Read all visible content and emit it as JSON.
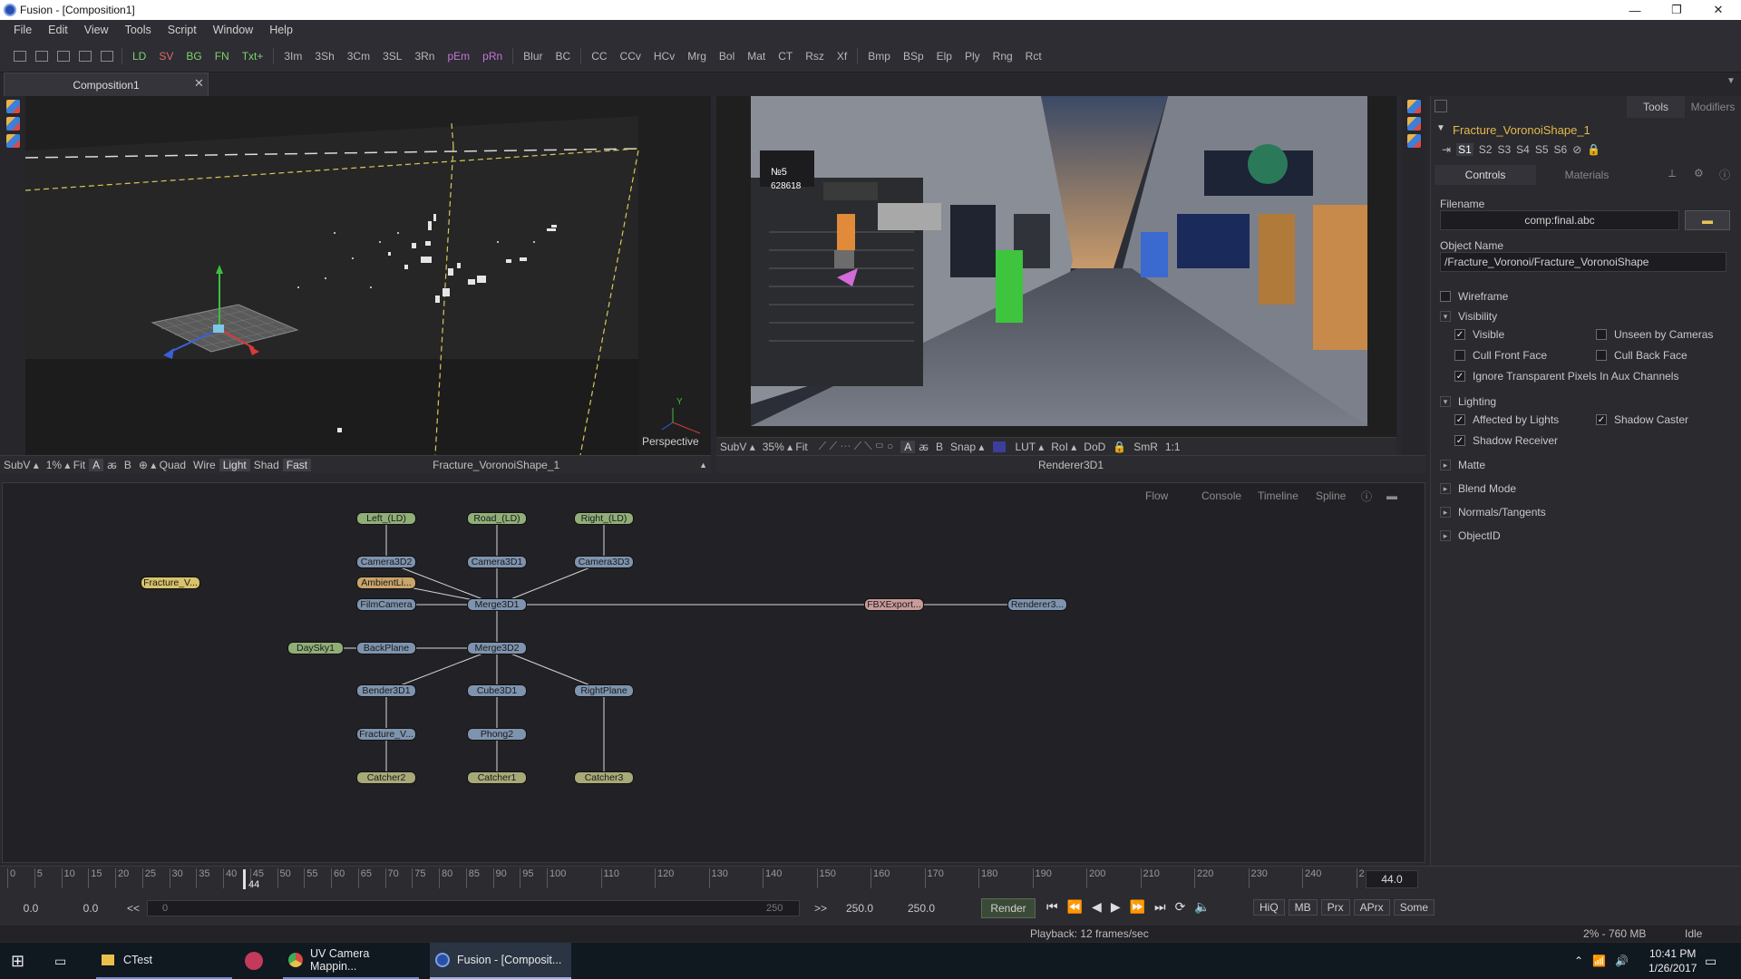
{
  "window": {
    "title": "Fusion - [Composition1]",
    "minimize": "—",
    "maximize": "❐",
    "close": "✕"
  },
  "menu": [
    "File",
    "Edit",
    "View",
    "Tools",
    "Script",
    "Window",
    "Help"
  ],
  "toolbar": [
    {
      "label": "LD",
      "color": "g"
    },
    {
      "label": "SV",
      "color": "r"
    },
    {
      "label": "BG",
      "color": "g"
    },
    {
      "label": "FN",
      "color": "g"
    },
    {
      "label": "Txt+",
      "color": "g"
    },
    {
      "label": "3Im"
    },
    {
      "label": "3Sh"
    },
    {
      "label": "3Cm"
    },
    {
      "label": "3SL"
    },
    {
      "label": "3Rn"
    },
    {
      "label": "pEm",
      "color": "p"
    },
    {
      "label": "pRn",
      "color": "p"
    },
    {
      "label": "Blur"
    },
    {
      "label": "BC"
    },
    {
      "label": "CC"
    },
    {
      "label": "CCv"
    },
    {
      "label": "HCv"
    },
    {
      "label": "Mrg"
    },
    {
      "label": "Bol"
    },
    {
      "label": "Mat"
    },
    {
      "label": "CT"
    },
    {
      "label": "Rsz"
    },
    {
      "label": "Xf"
    },
    {
      "label": "Bmp"
    },
    {
      "label": "BSp"
    },
    {
      "label": "Elp"
    },
    {
      "label": "Ply"
    },
    {
      "label": "Rng"
    },
    {
      "label": "Rct"
    }
  ],
  "tab": {
    "label": "Composition1",
    "close": "✕"
  },
  "viewer_left": {
    "label": "Perspective",
    "axis_y": "Y",
    "bar": [
      "SubV ▴",
      "1% ▴ Fit",
      "A",
      "ꬱ",
      "B",
      "⊕ ▴ Quad",
      "Wire",
      "Light",
      "Shad",
      "Fast"
    ],
    "node": "Fracture_VoronoiShape_1"
  },
  "viewer_right": {
    "bar": [
      "SubV ▴",
      "35% ▴ Fit",
      "A",
      "ꬱ",
      "B",
      "Snap ▴",
      "LUT ▴",
      "RoI ▴",
      "DoD",
      "SmR",
      "1:1"
    ],
    "node": "Renderer3D1",
    "sign_text": "№5",
    "shop_code": "628618"
  },
  "flow_tabs": [
    "Flow",
    "Console",
    "Timeline",
    "Spline"
  ],
  "nodes": [
    {
      "label": "Left_(LD)",
      "cls": "n-green"
    },
    {
      "label": "Road_(LD)",
      "cls": "n-green"
    },
    {
      "label": "Right_(LD)",
      "cls": "n-green"
    },
    {
      "label": "Camera3D2",
      "cls": "n-blue"
    },
    {
      "label": "Camera3D1",
      "cls": "n-blue"
    },
    {
      "label": "Camera3D3",
      "cls": "n-blue"
    },
    {
      "label": "Fracture_V...",
      "cls": "n-yellow"
    },
    {
      "label": "AmbientLi...",
      "cls": "n-orange"
    },
    {
      "label": "FilmCamera",
      "cls": "n-blue"
    },
    {
      "label": "Merge3D1",
      "cls": "n-blue"
    },
    {
      "label": "FBXExport...",
      "cls": "n-pink"
    },
    {
      "label": "Renderer3...",
      "cls": "n-blue"
    },
    {
      "label": "DaySky1",
      "cls": "n-green"
    },
    {
      "label": "BackPlane",
      "cls": "n-blue"
    },
    {
      "label": "Merge3D2",
      "cls": "n-blue"
    },
    {
      "label": "Bender3D1",
      "cls": "n-blue"
    },
    {
      "label": "Cube3D1",
      "cls": "n-blue"
    },
    {
      "label": "RightPlane",
      "cls": "n-blue"
    },
    {
      "label": "Fracture_V...",
      "cls": "n-blue"
    },
    {
      "label": "Phong2",
      "cls": "n-blue"
    },
    {
      "label": "Catcher2",
      "cls": "n-olive"
    },
    {
      "label": "Catcher1",
      "cls": "n-olive"
    },
    {
      "label": "Catcher3",
      "cls": "n-olive"
    }
  ],
  "inspector": {
    "tabs": [
      "Tools",
      "Modifiers"
    ],
    "tool_name": "Fracture_VoronoiShape_1",
    "slots": [
      "S1",
      "S2",
      "S3",
      "S4",
      "S5",
      "S6"
    ],
    "subtabs": [
      "Controls",
      "Materials"
    ],
    "filename_label": "Filename",
    "filename_value": "comp:final.abc",
    "objname_label": "Object Name",
    "objname_value": "/Fracture_Voronoi/Fracture_VoronoiShape",
    "wireframe": "Wireframe",
    "visibility": "Visibility",
    "visible": "Visible",
    "unseen": "Unseen by Cameras",
    "cull_front": "Cull Front Face",
    "cull_back": "Cull Back Face",
    "ignore_transparent": "Ignore Transparent Pixels In Aux Channels",
    "lighting": "Lighting",
    "affected": "Affected by Lights",
    "shadow_caster": "Shadow Caster",
    "shadow_receiver": "Shadow Receiver",
    "matte": "Matte",
    "blend": "Blend Mode",
    "normals": "Normals/Tangents",
    "objectid": "ObjectID"
  },
  "timeline": {
    "ticks": [
      "0",
      "5",
      "10",
      "15",
      "20",
      "25",
      "30",
      "35",
      "40",
      "45",
      "50",
      "55",
      "60",
      "65",
      "70",
      "75",
      "80",
      "85",
      "90",
      "95",
      "100",
      "110",
      "120",
      "130",
      "140",
      "150",
      "160",
      "170",
      "180",
      "190",
      "200",
      "210",
      "220",
      "230",
      "240",
      "2"
    ],
    "current": "44",
    "end": "44.0"
  },
  "transport": {
    "start": "0.0",
    "render_start": "0.0",
    "back": "<<",
    "range_start": "0",
    "range_end": "250",
    "fwd": ">>",
    "render_end": "250.0",
    "end": "250.0",
    "render": "Render",
    "toggles": [
      "HiQ",
      "MB",
      "Prx",
      "APrx",
      "Some"
    ]
  },
  "status": {
    "playback": "Playback: 12 frames/sec",
    "memory": "2% - 760 MB",
    "state": "Idle"
  },
  "taskbar": {
    "items": [
      "CTest",
      "UV Camera Mappin...",
      "Fusion - [Composit..."
    ],
    "time": "10:41 PM",
    "date": "1/26/2017"
  }
}
